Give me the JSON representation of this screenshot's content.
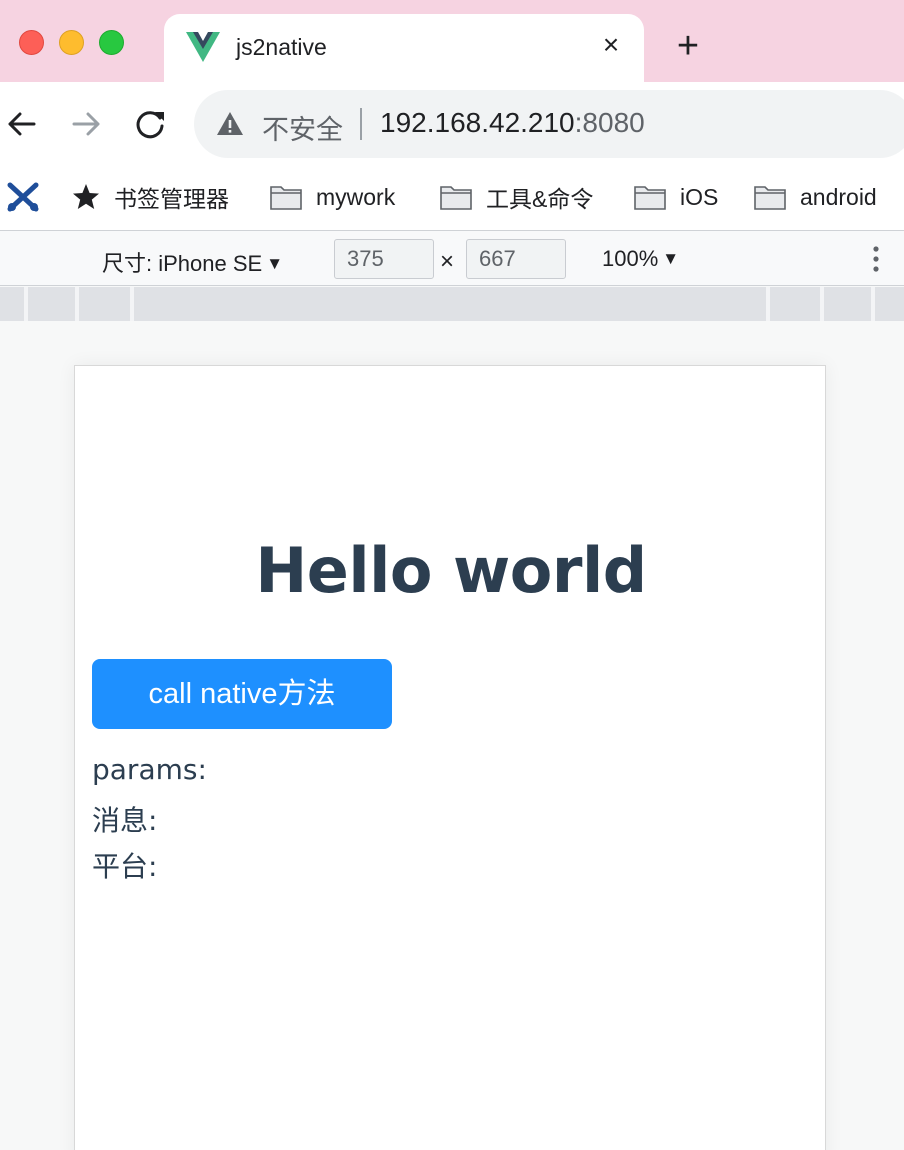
{
  "browser": {
    "tab": {
      "title": "js2native",
      "favicon": "vue-logo-icon"
    },
    "omnibox": {
      "security_label": "不安全",
      "url_host": "192.168.42.210",
      "url_port": ":8080"
    },
    "bookmarks": [
      {
        "label": "",
        "icon": "bookmark-app-icon"
      },
      {
        "label": "书签管理器",
        "icon": "star-icon"
      },
      {
        "label": "mywork",
        "icon": "folder-icon"
      },
      {
        "label": "工具&命令",
        "icon": "folder-icon"
      },
      {
        "label": "iOS",
        "icon": "folder-icon"
      },
      {
        "label": "android",
        "icon": "folder-icon"
      }
    ]
  },
  "device_toolbar": {
    "device_label": "尺寸: iPhone SE",
    "width": "375",
    "height": "667",
    "times": "×",
    "zoom": "100%"
  },
  "page": {
    "heading": "Hello world",
    "button_label": "call native方法",
    "params_label": "params:",
    "message_label": "消息:",
    "platform_label": "平台:"
  },
  "colors": {
    "tabstrip_bg": "#f6d3e1",
    "heading": "#2c3e50",
    "button_bg": "#1e90ff"
  }
}
